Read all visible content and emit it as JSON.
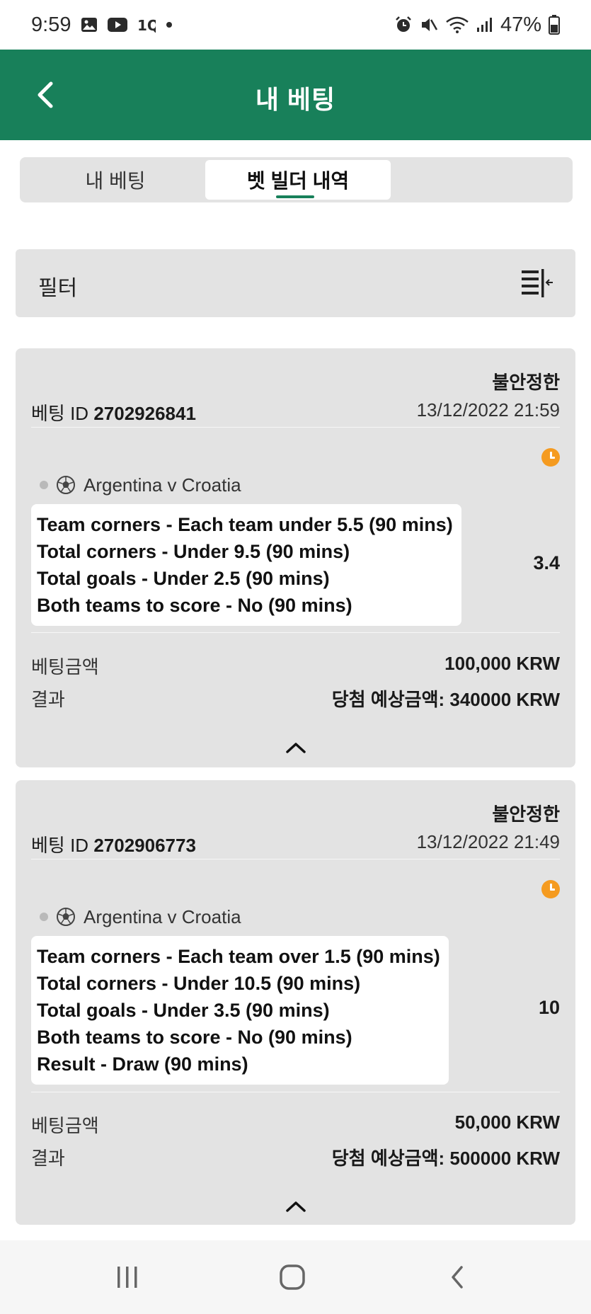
{
  "status_bar": {
    "time": "9:59",
    "battery": "47%",
    "left_icons": [
      "gallery-icon",
      "youtube-icon",
      "app-1q-icon",
      "notification-dot-icon"
    ],
    "right_icons": [
      "alarm-icon",
      "mute-icon",
      "wifi-icon",
      "signal-icon",
      "battery-icon"
    ]
  },
  "appbar": {
    "title": "내 베팅",
    "back_icon": "back-arrow-icon"
  },
  "tabs": [
    {
      "label": "내 베팅",
      "active": false
    },
    {
      "label": "벳 빌더 내역",
      "active": true
    }
  ],
  "filter": {
    "label": "필터",
    "icon": "filter-collapse-icon"
  },
  "bets": [
    {
      "status": "불안정한",
      "id_label": "베팅 ID",
      "id": "2702926841",
      "date": "13/12/2022 21:59",
      "match": "Argentina v Croatia",
      "selections": [
        "Team corners - Each team under 5.5 (90 mins)",
        "Total corners - Under 9.5 (90 mins)",
        "Total goals - Under 2.5 (90 mins)",
        "Both teams to score - No (90 mins)"
      ],
      "odds": "3.4",
      "stake_label": "베팅금액",
      "stake": "100,000 KRW",
      "result_label": "결과",
      "result": "당첨 예상금액: 340000 KRW"
    },
    {
      "status": "불안정한",
      "id_label": "베팅 ID",
      "id": "2702906773",
      "date": "13/12/2022 21:49",
      "match": "Argentina v Croatia",
      "selections": [
        "Team corners - Each team over 1.5 (90 mins)",
        "Total corners - Under 10.5 (90 mins)",
        "Total goals - Under 3.5 (90 mins)",
        "Both teams to score - No (90 mins)",
        "Result - Draw (90 mins)"
      ],
      "odds": "10",
      "stake_label": "베팅금액",
      "stake": "50,000 KRW",
      "result_label": "결과",
      "result": "당첨 예상금액: 500000 KRW"
    }
  ],
  "colors": {
    "brand_green": "#18805a",
    "pending_orange": "#f59b20",
    "card_bg": "#e3e3e3"
  }
}
